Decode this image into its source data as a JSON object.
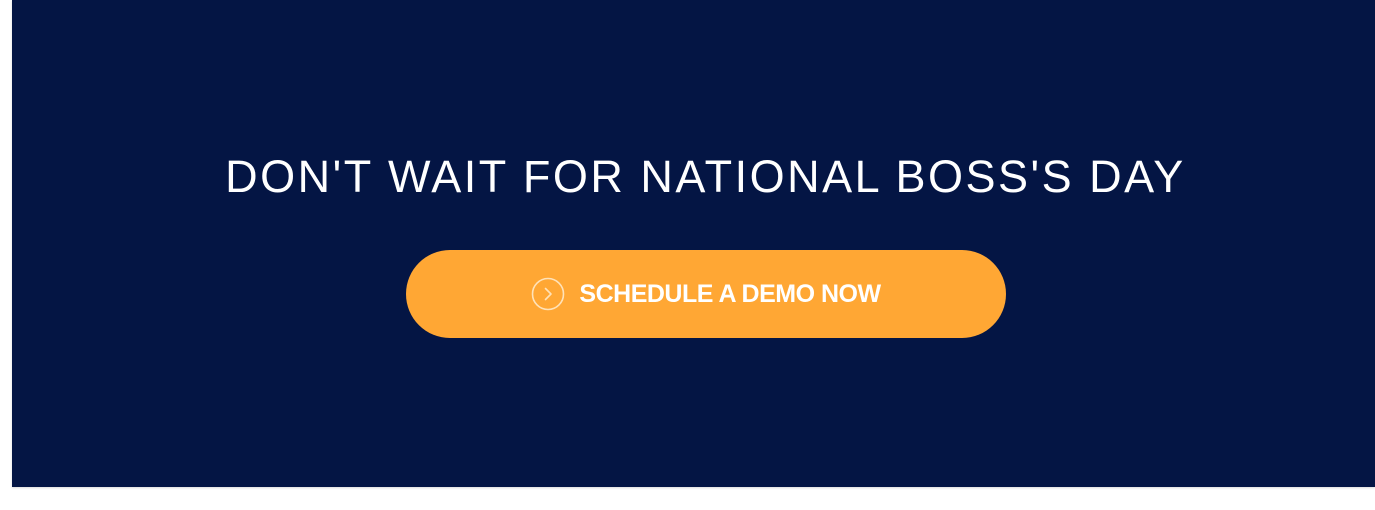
{
  "banner": {
    "headline": "DON'T WAIT FOR NATIONAL BOSS'S DAY",
    "cta_label": "SCHEDULE A DEMO NOW",
    "cta_icon": "chevron-right-circle-icon"
  },
  "colors": {
    "background": "#041544",
    "cta": "#ffa734",
    "text": "#ffffff"
  }
}
